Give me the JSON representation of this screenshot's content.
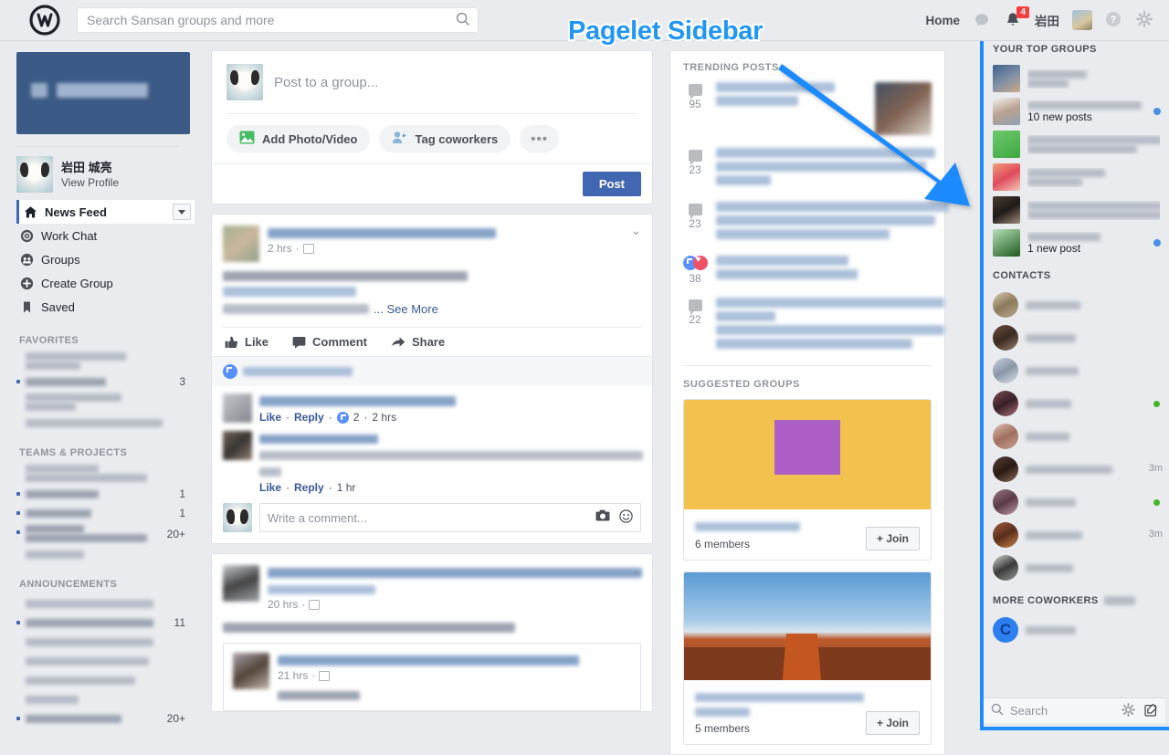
{
  "annotation": {
    "label": "Pagelet Sidebar",
    "color": "#2196f3"
  },
  "topbar": {
    "logo_icon": "workplace-logo-icon",
    "search": {
      "placeholder": "Search Sansan groups and more",
      "value": "",
      "icon": "search-icon"
    },
    "home_label": "Home",
    "messages_icon": "chat-bubble-icon",
    "notifications_icon": "bell-icon",
    "notifications_count": "4",
    "user_name": "岩田",
    "help_icon": "question-circle-icon",
    "settings_icon": "gear-icon"
  },
  "left_sidebar": {
    "cover_banner": {
      "name": "cover-banner",
      "text": ""
    },
    "profile": {
      "name": "岩田 城亮",
      "link": "View Profile"
    },
    "nav": [
      {
        "label": "News Feed",
        "icon": "home-icon",
        "active": true,
        "has_caret": true
      },
      {
        "label": "Work Chat",
        "icon": "chat-circle-icon",
        "active": false
      },
      {
        "label": "Groups",
        "icon": "groups-icon",
        "active": false
      },
      {
        "label": "Create Group",
        "icon": "plus-circle-icon",
        "active": false
      },
      {
        "label": "Saved",
        "icon": "bookmark-icon",
        "active": false
      }
    ],
    "sections": [
      {
        "title": "FAVORITES",
        "items": [
          {
            "count": "",
            "unread": false,
            "lines": [
              [
                110,
                60
              ]
            ]
          },
          {
            "count": "3",
            "unread": true,
            "lines": [
              [
                88
              ]
            ]
          },
          {
            "count": "",
            "unread": false,
            "lines": [
              [
                105,
                55
              ]
            ]
          },
          {
            "count": "",
            "unread": false,
            "lines": [
              [
                150
              ]
            ]
          }
        ]
      },
      {
        "title": "TEAMS & PROJECTS",
        "items": [
          {
            "count": "",
            "unread": false,
            "lines": [
              [
                80
              ],
              [
                133
              ]
            ]
          },
          {
            "count": "1",
            "unread": true,
            "lines": [
              [
                80
              ]
            ]
          },
          {
            "count": "1",
            "unread": true,
            "lines": [
              [
                72
              ]
            ]
          },
          {
            "count": "20+",
            "unread": true,
            "lines": [
              [
                64
              ],
              [
                133
              ]
            ]
          },
          {
            "count": "",
            "unread": false,
            "lines": [
              [
                64
              ]
            ]
          }
        ]
      },
      {
        "title": "ANNOUNCEMENTS",
        "items": [
          {
            "count": "",
            "unread": false,
            "lines": [
              [
                140
              ]
            ]
          },
          {
            "count": "11",
            "unread": true,
            "lines": [
              [
                140
              ]
            ]
          },
          {
            "count": "",
            "unread": false,
            "lines": [
              [
                140
              ]
            ]
          },
          {
            "count": "",
            "unread": false,
            "lines": [
              [
                135
              ]
            ]
          },
          {
            "count": "",
            "unread": false,
            "lines": [
              [
                120
              ]
            ]
          },
          {
            "count": "",
            "unread": false,
            "lines": [
              [
                58
              ]
            ]
          },
          {
            "count": "20+",
            "unread": true,
            "lines": [
              [
                105
              ]
            ]
          }
        ]
      }
    ]
  },
  "composer": {
    "placeholder": "Post to a group...",
    "actions": [
      {
        "label": "Add Photo/Video",
        "icon": "photo-icon"
      },
      {
        "label": "Tag coworkers",
        "icon": "tag-person-icon"
      },
      {
        "label": "•••",
        "icon": "more-options-icon"
      }
    ],
    "post_button": "Post"
  },
  "feed": {
    "posts": [
      {
        "timestamp": "2 hrs",
        "audience_icon": "audience-group-icon",
        "see_more": "... See More",
        "actions": [
          {
            "label": "Like",
            "icon": "thumbs-up-icon"
          },
          {
            "label": "Comment",
            "icon": "comment-icon"
          },
          {
            "label": "Share",
            "icon": "share-arrow-icon"
          }
        ],
        "reactions_icon": "thumbs-up-badge-icon",
        "comments": [
          {
            "meta_like": "Like",
            "meta_reply": "Reply",
            "like_count": "2",
            "time": "2 hrs"
          },
          {
            "meta_like": "Like",
            "meta_reply": "Reply",
            "like_count": "",
            "time": "1 hr"
          }
        ],
        "comment_placeholder": "Write a comment...",
        "comment_icons": [
          "camera-icon",
          "emoji-icon"
        ]
      },
      {
        "timestamp": "20 hrs",
        "audience_icon": "audience-group-icon",
        "shared_timestamp": "21 hrs"
      }
    ]
  },
  "right_column": {
    "trending_title": "TRENDING POSTS",
    "trending": [
      {
        "count": "95",
        "icon": "comment-icon",
        "has_thumb": true,
        "lines": [
          130,
          90
        ]
      },
      {
        "count": "23",
        "icon": "comment-icon",
        "has_thumb": false,
        "lines": [
          240,
          230,
          60
        ]
      },
      {
        "count": "23",
        "icon": "comment-icon",
        "has_thumb": false,
        "lines": [
          255,
          240,
          190
        ]
      },
      {
        "count": "38",
        "icon": "like-heart-reactions-icon",
        "has_thumb": false,
        "lines": [
          145,
          155
        ]
      },
      {
        "count": "22",
        "icon": "comment-icon",
        "has_thumb": false,
        "lines": [
          250,
          65,
          250,
          215
        ]
      }
    ],
    "suggested_title": "SUGGESTED GROUPS",
    "suggested_groups": [
      {
        "members": "6 members",
        "join": "+ Join",
        "image": "yellow-chart-poster"
      },
      {
        "members": "5 members",
        "join": "+ Join",
        "image": "desert-mesa-landscape"
      }
    ]
  },
  "pagelet_sidebar": {
    "top_groups_title": "YOUR TOP GROUPS",
    "top_groups": [
      {
        "new_posts": "",
        "has_dot": false,
        "avatar": "blue-photo",
        "lines": [
          65,
          45
        ]
      },
      {
        "new_posts": "10 new posts",
        "has_dot": true,
        "avatar": "light-photo",
        "lines": [
          125
        ]
      },
      {
        "new_posts": "",
        "has_dot": false,
        "avatar": "green-block",
        "lines": [
          150,
          120
        ]
      },
      {
        "new_posts": "",
        "has_dot": false,
        "avatar": "red-pattern",
        "lines": [
          85,
          60
        ]
      },
      {
        "new_posts": "",
        "has_dot": false,
        "avatar": "dark-photo",
        "lines": [
          150,
          150
        ]
      },
      {
        "new_posts": "1 new post",
        "has_dot": true,
        "avatar": "green-gradient",
        "lines": [
          80
        ]
      }
    ],
    "contacts_title": "CONTACTS",
    "contacts": [
      {
        "time": "",
        "online": false,
        "lines": [
          60
        ]
      },
      {
        "time": "",
        "online": false,
        "lines": [
          55
        ]
      },
      {
        "time": "",
        "online": false,
        "lines": [
          58
        ]
      },
      {
        "time": "",
        "online": true,
        "lines": [
          50
        ]
      },
      {
        "time": "",
        "online": false,
        "lines": [
          48
        ]
      },
      {
        "time": "3m",
        "online": false,
        "lines": [
          95
        ]
      },
      {
        "time": "",
        "online": true,
        "lines": [
          55
        ]
      },
      {
        "time": "3m",
        "online": false,
        "lines": [
          62
        ]
      },
      {
        "time": "",
        "online": false,
        "lines": [
          52
        ]
      }
    ],
    "more_coworkers_title": "MORE COWORKERS",
    "more_coworkers": [
      {
        "avatar_letter": "C",
        "lines": [
          55
        ]
      }
    ],
    "footer": {
      "search_placeholder": "Search",
      "settings_icon": "gear-icon",
      "compose_icon": "compose-icon"
    }
  }
}
